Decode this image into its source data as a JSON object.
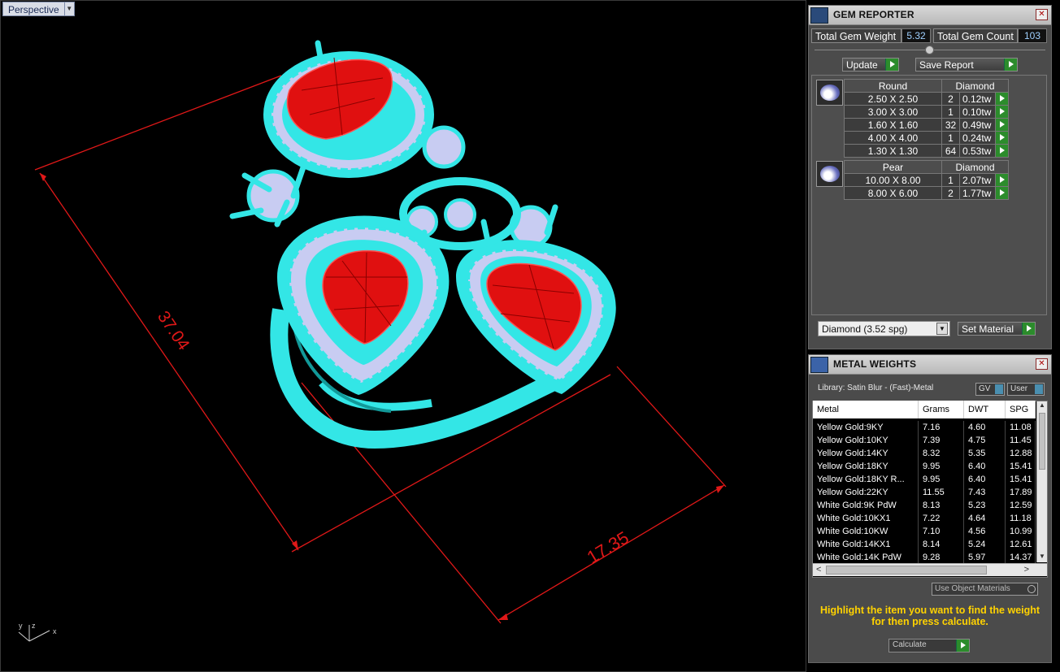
{
  "viewport": {
    "label": "Perspective",
    "dimensions": [
      "37.04",
      "17.35"
    ],
    "axes": {
      "x": "x",
      "y": "y",
      "z": "z"
    },
    "colors": {
      "wire": "#33e6e6",
      "gem": "#e01010",
      "dim": "#e01818",
      "stone": "#c8ccf2"
    }
  },
  "gem_reporter": {
    "title": "GEM REPORTER",
    "total_weight_label": "Total Gem Weight",
    "total_weight_value": "5.32",
    "total_count_label": "Total Gem Count",
    "total_count_value": "103",
    "update_label": "Update",
    "save_label": "Save Report",
    "groups": [
      {
        "shape": "Round",
        "material": "Diamond",
        "icon": "round-gem-icon",
        "rows": [
          {
            "size": "2.50 X 2.50",
            "count": "2",
            "weight": "0.12tw"
          },
          {
            "size": "3.00 X 3.00",
            "count": "1",
            "weight": "0.10tw"
          },
          {
            "size": "1.60 X 1.60",
            "count": "32",
            "weight": "0.49tw"
          },
          {
            "size": "4.00 X 4.00",
            "count": "1",
            "weight": "0.24tw"
          },
          {
            "size": "1.30 X 1.30",
            "count": "64",
            "weight": "0.53tw"
          }
        ]
      },
      {
        "shape": "Pear",
        "material": "Diamond",
        "icon": "pear-gem-icon",
        "rows": [
          {
            "size": "10.00 X 8.00",
            "count": "1",
            "weight": "2.07tw"
          },
          {
            "size": "8.00 X 6.00",
            "count": "2",
            "weight": "1.77tw"
          }
        ]
      }
    ],
    "material_select": "Diamond    (3.52 spg)",
    "set_material_label": "Set Material"
  },
  "metal_weights": {
    "title": "METAL WEIGHTS",
    "library_label": "Library: Satin Blur - (Fast)-Metal",
    "gv_label": "GV",
    "user_label": "User",
    "columns": [
      "Metal",
      "Grams",
      "DWT",
      "SPG"
    ],
    "rows": [
      [
        "Yellow Gold:9KY",
        "7.16",
        "4.60",
        "11.08"
      ],
      [
        "Yellow Gold:10KY",
        "7.39",
        "4.75",
        "11.45"
      ],
      [
        "Yellow Gold:14KY",
        "8.32",
        "5.35",
        "12.88"
      ],
      [
        "Yellow Gold:18KY",
        "9.95",
        "6.40",
        "15.41"
      ],
      [
        "Yellow Gold:18KY R...",
        "9.95",
        "6.40",
        "15.41"
      ],
      [
        "Yellow Gold:22KY",
        "11.55",
        "7.43",
        "17.89"
      ],
      [
        "White Gold:9K PdW",
        "8.13",
        "5.23",
        "12.59"
      ],
      [
        "White Gold:10KX1",
        "7.22",
        "4.64",
        "11.18"
      ],
      [
        "White Gold:10KW",
        "7.10",
        "4.56",
        "10.99"
      ],
      [
        "White Gold:14KX1",
        "8.14",
        "5.24",
        "12.61"
      ],
      [
        "White Gold:14K PdW",
        "9.28",
        "5.97",
        "14.37"
      ]
    ],
    "use_object_label": "Use Object Materials",
    "instruction": "Highlight the item you want to find the weight for then press calculate.",
    "calculate_label": "Calculate"
  }
}
